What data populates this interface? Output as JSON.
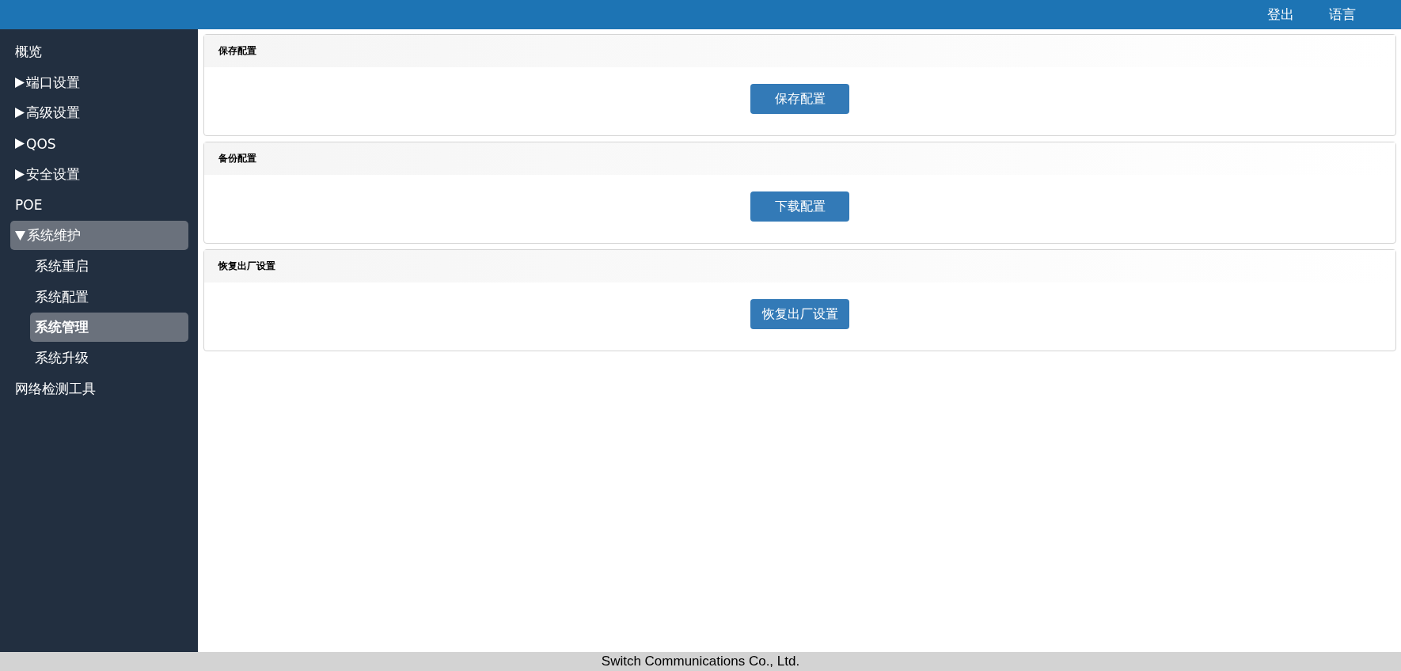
{
  "header": {
    "links": [
      "登出",
      "语言"
    ]
  },
  "sidebar": {
    "items": [
      {
        "label": "概览",
        "selected": false
      },
      {
        "label": "端口设置",
        "selected": false,
        "expanded": false
      },
      {
        "label": "高级设置",
        "selected": false,
        "expanded": false
      },
      {
        "label": "QOS",
        "selected": false,
        "expanded": false
      },
      {
        "label": "安全设置",
        "selected": false,
        "expanded": false
      },
      {
        "label": "POE",
        "selected": false
      },
      {
        "label": "系统维护",
        "selected": true,
        "expanded": true,
        "children": [
          {
            "label": "系统重启",
            "selected": false
          },
          {
            "label": "系统配置",
            "selected": false
          },
          {
            "label": "系统管理",
            "selected": true
          },
          {
            "label": "系统升级",
            "selected": false
          }
        ]
      },
      {
        "label": "网络检测工具",
        "selected": false
      }
    ]
  },
  "panels": [
    {
      "title": "保存配置",
      "button": "保存配置"
    },
    {
      "title": "备份配置",
      "button": "下载配置"
    },
    {
      "title": "恢复出厂设置",
      "button": "恢复出厂设置"
    }
  ],
  "footer": {
    "text": "Switch Communications Co., Ltd."
  }
}
